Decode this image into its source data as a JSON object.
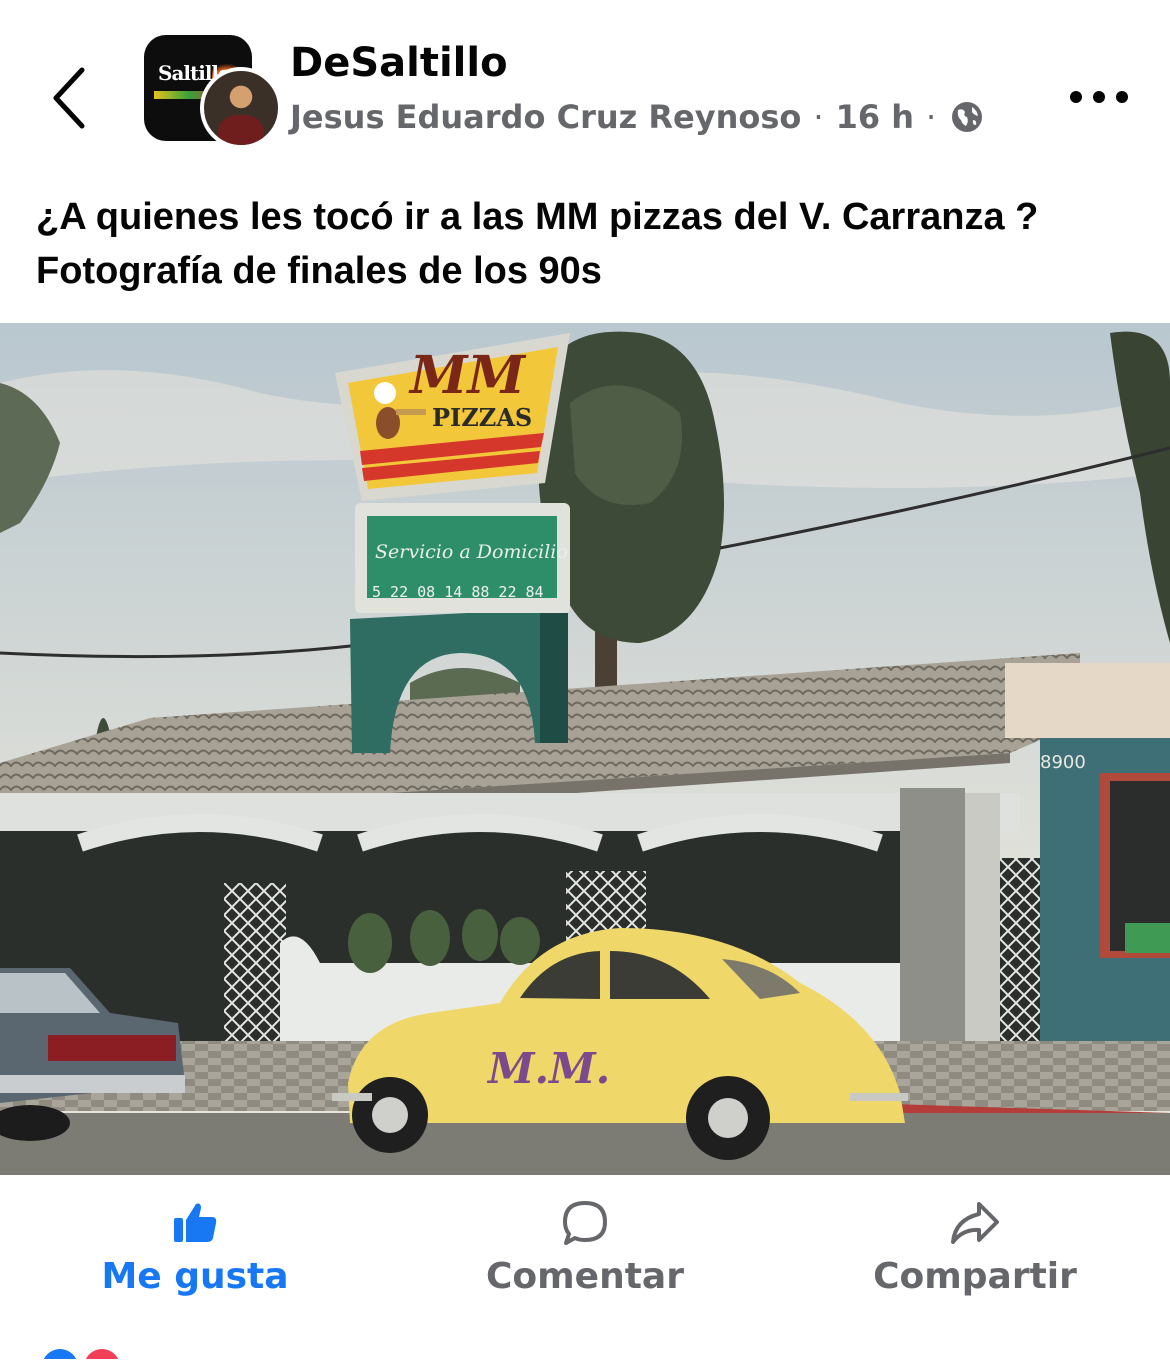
{
  "header": {
    "page_name": "DeSaltillo",
    "author": "Jesus Eduardo Cruz Reynoso",
    "separator": "·",
    "time": "16 h",
    "privacy_icon": "globe-icon",
    "back_icon": "chevron-left-icon",
    "more_icon": "more-horizontal-icon",
    "page_avatar_logo_text": "Saltillo"
  },
  "post": {
    "text": "¿A quienes les tocó ir a las MM pizzas del V. Carranza ? Fotografía de finales de los 90s"
  },
  "photo": {
    "sign_brand": "MM",
    "sign_text": "PIZZAS",
    "sign_lower": "Servicio a Domicilio",
    "sign_phone": "5 22 08 14 88 22 84",
    "building_number": "8900",
    "car_text": "M.M."
  },
  "actions": [
    {
      "label": "Me gusta",
      "icon": "thumbs-up-icon",
      "color": "#1877f2"
    },
    {
      "label": "Comentar",
      "icon": "comment-icon",
      "color": "#65676b"
    },
    {
      "label": "Compartir",
      "icon": "share-icon",
      "color": "#65676b"
    }
  ]
}
